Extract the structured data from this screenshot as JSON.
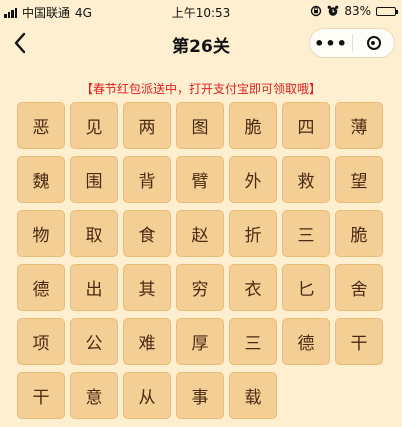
{
  "status": {
    "carrier": "中国联通",
    "network": "4G",
    "time": "上午10:53",
    "battery": "83%",
    "battery_level": 0.83
  },
  "nav": {
    "title": "第26关"
  },
  "promo": "【春节红包派送中，打开支付宝即可领取哦】",
  "tiles": [
    "恶",
    "见",
    "两",
    "图",
    "脆",
    "四",
    "薄",
    "魏",
    "围",
    "背",
    "臂",
    "外",
    "救",
    "望",
    "物",
    "取",
    "食",
    "赵",
    "折",
    "三",
    "脆",
    "德",
    "出",
    "其",
    "穷",
    "衣",
    "匕",
    "舍",
    "项",
    "公",
    "难",
    "厚",
    "三",
    "德",
    "干",
    "干",
    "意",
    "从",
    "事",
    "载"
  ]
}
